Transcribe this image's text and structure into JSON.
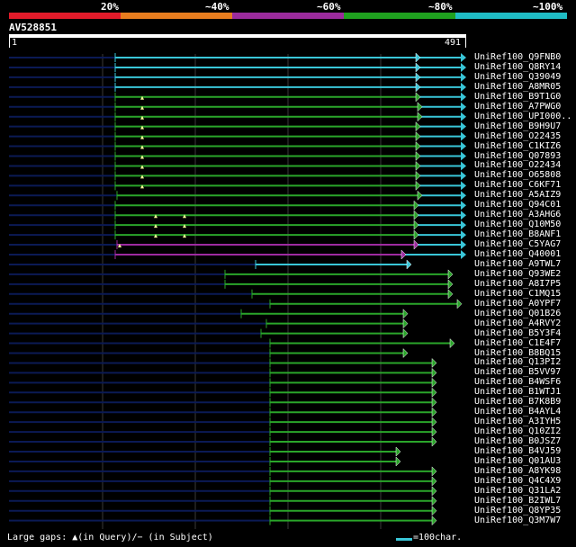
{
  "header": {
    "percents": [
      "20%",
      "~40%",
      "~60%",
      "~80%",
      "~100%"
    ],
    "colors": [
      "#e21b2a",
      "#e87d1e",
      "#9b2b9c",
      "#1fa11f",
      "#1fbcc4"
    ]
  },
  "query": {
    "name": "AV528851",
    "start": "1",
    "end": "491"
  },
  "colors": {
    "cyan": "#39c6d8",
    "green": "#2aa52a",
    "magenta": "#9e2aa0",
    "navy": "#0b1a55",
    "grid": "#3a3a3a",
    "marker": "#fffb9a"
  },
  "hits": [
    {
      "label": "UniRef100_Q9FNB0",
      "color": "cyan"
    },
    {
      "label": "UniRef100_Q8RY14",
      "color": "cyan"
    },
    {
      "label": "UniRef100_Q39049",
      "color": "cyan"
    },
    {
      "label": "UniRef100_A8MR05",
      "color": "cyan"
    },
    {
      "label": "UniRef100_B9T1G0",
      "color": "green"
    },
    {
      "label": "UniRef100_A7PWG0",
      "color": "green"
    },
    {
      "label": "UniRef100_UPI000..",
      "color": "green"
    },
    {
      "label": "UniRef100_B9H9U7",
      "color": "green"
    },
    {
      "label": "UniRef100_O22435",
      "color": "green"
    },
    {
      "label": "UniRef100_C1KIZ6",
      "color": "green"
    },
    {
      "label": "UniRef100_Q07893",
      "color": "green"
    },
    {
      "label": "UniRef100_O22434",
      "color": "green"
    },
    {
      "label": "UniRef100_O65808",
      "color": "green"
    },
    {
      "label": "UniRef100_C6KF71",
      "color": "green"
    },
    {
      "label": "UniRef100_A5AIZ9",
      "color": "green"
    },
    {
      "label": "UniRef100_Q94C01",
      "color": "green"
    },
    {
      "label": "UniRef100_A3AHG6",
      "color": "green"
    },
    {
      "label": "UniRef100_Q10M50",
      "color": "green"
    },
    {
      "label": "UniRef100_B8ANF1",
      "color": "green"
    },
    {
      "label": "UniRef100_C5YAG7",
      "color": "magenta"
    },
    {
      "label": "UniRef100_Q40001",
      "color": "magenta"
    },
    {
      "label": "UniRef100_A9TWL7",
      "color": "cyan"
    },
    {
      "label": "UniRef100_Q93WE2",
      "color": "green"
    },
    {
      "label": "UniRef100_A8I7P5",
      "color": "green"
    },
    {
      "label": "UniRef100_C1MQ15",
      "color": "green"
    },
    {
      "label": "UniRef100_A0YPF7",
      "color": "green"
    },
    {
      "label": "UniRef100_Q01B26",
      "color": "green"
    },
    {
      "label": "UniRef100_A4RVY2",
      "color": "green"
    },
    {
      "label": "UniRef100_B5Y3F4",
      "color": "green"
    },
    {
      "label": "UniRef100_C1E4F7",
      "color": "green"
    },
    {
      "label": "UniRef100_B8BQ15",
      "color": "green"
    },
    {
      "label": "UniRef100_Q13PI2",
      "color": "green"
    },
    {
      "label": "UniRef100_B5VV97",
      "color": "green"
    },
    {
      "label": "UniRef100_B4WSF6",
      "color": "green"
    },
    {
      "label": "UniRef100_B1WTJ1",
      "color": "green"
    },
    {
      "label": "UniRef100_B7K8B9",
      "color": "green"
    },
    {
      "label": "UniRef100_B4AYL4",
      "color": "green"
    },
    {
      "label": "UniRef100_A3IYH5",
      "color": "green"
    },
    {
      "label": "UniRef100_Q10ZI2",
      "color": "green"
    },
    {
      "label": "UniRef100_B0JSZ7",
      "color": "green"
    },
    {
      "label": "UniRef100_B4VJ59",
      "color": "green"
    },
    {
      "label": "UniRef100_Q01AU3",
      "color": "green"
    },
    {
      "label": "UniRef100_A8YK98",
      "color": "green"
    },
    {
      "label": "UniRef100_Q4C4X9",
      "color": "green"
    },
    {
      "label": "UniRef100_Q31LA2",
      "color": "green"
    },
    {
      "label": "UniRef100_B2IWL7",
      "color": "green"
    },
    {
      "label": "UniRef100_Q8YP35",
      "color": "green"
    },
    {
      "label": "UniRef100_Q3M7W7",
      "color": "green"
    }
  ],
  "footer": {
    "gaps_text": "Large gaps: ▲(in Query)/− (in Subject)",
    "scale_text": "=100char."
  }
}
